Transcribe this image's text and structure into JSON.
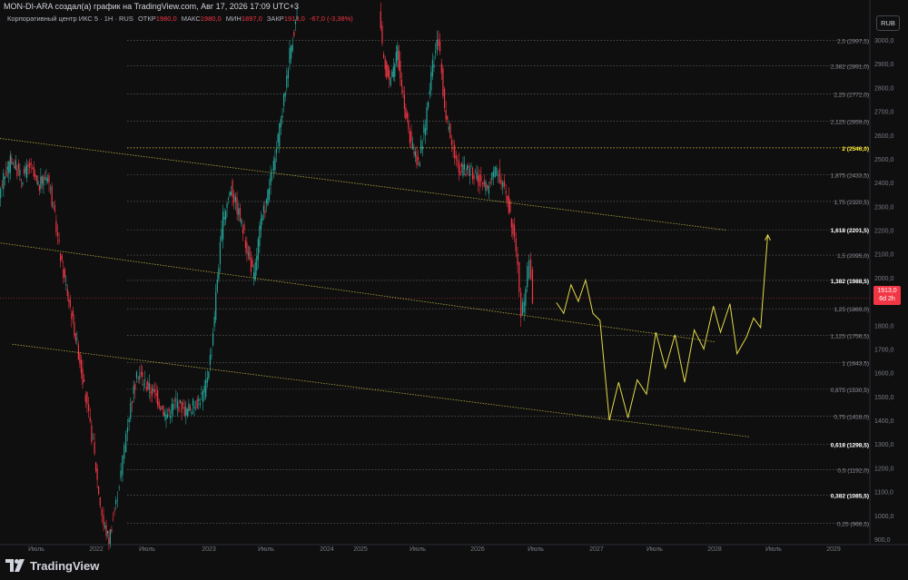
{
  "header": {
    "credit": "MON-DI-ARA создал(а) график на TradingView.com, Авг 17, 2026 17:09 UTC+3",
    "symbol": "Корпоративный центр ИКС 5 · 1Н · RUS",
    "open_label": "ОТКР",
    "open_value": "1980,0",
    "high_label": "МАКС",
    "high_value": "1980,0",
    "low_label": "МИН",
    "low_value": "1897,0",
    "close_label": "ЗАКР",
    "close_value": "1913,0",
    "change": "-67,0 (-3,38%)"
  },
  "currency": "RUB",
  "price_tag": {
    "value": "1913,0",
    "countdown": "6d 2h"
  },
  "brand": {
    "name": "TradingView",
    "icon": "tradingview-logo-icon"
  },
  "colors": {
    "background": "#0f0f0f",
    "up": "#26a69a",
    "down": "#f23645",
    "fib_line": "#8a8a8a",
    "fib_highlight": "#ffeb3b",
    "trend": "#d4c84a",
    "projection": "#e3d94a",
    "axis_text": "#787b86"
  },
  "chart_data": {
    "type": "candlestick",
    "title": "",
    "xlabel": "",
    "ylabel": "",
    "ylim": [
      850,
      3100
    ],
    "grid": false,
    "y_ticks": [
      900,
      1000,
      1100,
      1200,
      1300,
      1400,
      1500,
      1600,
      1700,
      1800,
      1900,
      2000,
      2100,
      2200,
      2300,
      2400,
      2500,
      2600,
      2700,
      2800,
      2900,
      3000
    ],
    "y_tick_labels": [
      "900,0",
      "1000,0",
      "1100,0",
      "1200,0",
      "1300,0",
      "1400,0",
      "1500,0",
      "1600,0",
      "1700,0",
      "1800,0",
      "1900,0",
      "2000,0",
      "2100,0",
      "2200,0",
      "2300,0",
      "2400,0",
      "2500,0",
      "2600,0",
      "2700,0",
      "2800,0",
      "2900,0",
      "3000,0"
    ],
    "x_labels": [
      {
        "t": 2021.5,
        "label": "Июль"
      },
      {
        "t": 2022.0,
        "label": "2022"
      },
      {
        "t": 2022.5,
        "label": "Июль"
      },
      {
        "t": 2023.0,
        "label": "2023"
      },
      {
        "t": 2023.5,
        "label": "Июль"
      },
      {
        "t": 2024.0,
        "label": "2024"
      },
      {
        "t": 2024.25,
        "label": "2025"
      },
      {
        "t": 2024.75,
        "label": "Июль"
      },
      {
        "t": 2025.25,
        "label": "2026"
      },
      {
        "t": 2025.75,
        "label": "Июль"
      },
      {
        "t": 2026.25,
        "label": "2027"
      },
      {
        "t": 2026.75,
        "label": "Июль"
      },
      {
        "t": 2027.25,
        "label": "2028"
      },
      {
        "t": 2027.75,
        "label": "Июль"
      },
      {
        "t": 2028.25,
        "label": "2029"
      }
    ],
    "fib_levels": [
      {
        "ratio": "2,5",
        "price": 2997.5,
        "label": "2,5 (2997,5)"
      },
      {
        "ratio": "2,382",
        "price": 2891.0,
        "label": "2,382 (2891,0)"
      },
      {
        "ratio": "2,25",
        "price": 2772.0,
        "label": "2,25 (2772,0)"
      },
      {
        "ratio": "2,125",
        "price": 2659.0,
        "label": "2,125 (2659,0)"
      },
      {
        "ratio": "2",
        "price": 2546.0,
        "label": "2 (2546,0)",
        "highlight": true
      },
      {
        "ratio": "1,875",
        "price": 2433.5,
        "label": "1,875 (2433,5)"
      },
      {
        "ratio": "1,75",
        "price": 2320.5,
        "label": "1,75 (2320,5)"
      },
      {
        "ratio": "1,618",
        "price": 2201.5,
        "label": "1,618 (2201,5)",
        "bold": true
      },
      {
        "ratio": "1,5",
        "price": 2095.0,
        "label": "1,5 (2095,0)"
      },
      {
        "ratio": "1,382",
        "price": 1988.5,
        "label": "1,382 (1988,5)",
        "bold": true
      },
      {
        "ratio": "1,25",
        "price": 1869.0,
        "label": "1,25 (1869,0)"
      },
      {
        "ratio": "1,125",
        "price": 1756.5,
        "label": "1,125 (1756,5)"
      },
      {
        "ratio": "1",
        "price": 1643.5,
        "label": "1 (1643,5)"
      },
      {
        "ratio": "0,875",
        "price": 1530.5,
        "label": "0,875 (1530,5)"
      },
      {
        "ratio": "0,75",
        "price": 1418.0,
        "label": "0,75 (1418,0)"
      },
      {
        "ratio": "0,618",
        "price": 1298.5,
        "label": "0,618 (1298,5)",
        "bold": true
      },
      {
        "ratio": "0,5",
        "price": 1192.0,
        "label": "0,5 (1192,0)"
      },
      {
        "ratio": "0,382",
        "price": 1085.5,
        "label": "0,382 (1085,5)",
        "bold": true
      },
      {
        "ratio": "0,25",
        "price": 966.5,
        "label": "0,25 (966,5)"
      }
    ],
    "price_path": [
      [
        2021.0,
        2430
      ],
      [
        2021.1,
        2300
      ],
      [
        2021.15,
        2180
      ],
      [
        2021.22,
        2400
      ],
      [
        2021.3,
        2500
      ],
      [
        2021.38,
        2420
      ],
      [
        2021.45,
        2470
      ],
      [
        2021.52,
        2380
      ],
      [
        2021.6,
        2440
      ],
      [
        2021.66,
        2250
      ],
      [
        2021.72,
        2050
      ],
      [
        2021.8,
        1850
      ],
      [
        2021.88,
        1620
      ],
      [
        2021.93,
        1450
      ],
      [
        2021.98,
        1300
      ],
      [
        2022.03,
        1100
      ],
      [
        2022.08,
        960
      ],
      [
        2022.13,
        900
      ],
      [
        2022.2,
        1050
      ],
      [
        2022.25,
        1180
      ],
      [
        2022.3,
        1350
      ],
      [
        2022.36,
        1500
      ],
      [
        2022.42,
        1600
      ],
      [
        2022.5,
        1550
      ],
      [
        2022.58,
        1500
      ],
      [
        2022.66,
        1420
      ],
      [
        2022.74,
        1480
      ],
      [
        2022.82,
        1440
      ],
      [
        2022.9,
        1470
      ],
      [
        2022.97,
        1520
      ],
      [
        2023.03,
        1700
      ],
      [
        2023.08,
        2000
      ],
      [
        2023.13,
        2250
      ],
      [
        2023.2,
        2380
      ],
      [
        2023.28,
        2250
      ],
      [
        2023.35,
        2100
      ],
      [
        2023.4,
        2000
      ],
      [
        2023.45,
        2200
      ],
      [
        2023.52,
        2350
      ],
      [
        2023.58,
        2500
      ],
      [
        2023.64,
        2700
      ],
      [
        2023.7,
        2950
      ],
      [
        2023.76,
        3100
      ]
    ],
    "price_path_2": [
      [
        2024.42,
        3100
      ],
      [
        2024.46,
        2900
      ],
      [
        2024.52,
        2820
      ],
      [
        2024.58,
        2950
      ],
      [
        2024.64,
        2700
      ],
      [
        2024.7,
        2560
      ],
      [
        2024.76,
        2480
      ],
      [
        2024.82,
        2650
      ],
      [
        2024.88,
        2900
      ],
      [
        2024.93,
        3000
      ],
      [
        2024.98,
        2720
      ],
      [
        2025.04,
        2550
      ],
      [
        2025.1,
        2460
      ],
      [
        2025.18,
        2450
      ],
      [
        2025.26,
        2420
      ],
      [
        2025.34,
        2380
      ],
      [
        2025.42,
        2450
      ],
      [
        2025.5,
        2360
      ],
      [
        2025.56,
        2200
      ],
      [
        2025.6,
        2050
      ],
      [
        2025.63,
        1830
      ],
      [
        2025.67,
        1950
      ],
      [
        2025.7,
        2100
      ],
      [
        2025.73,
        1913
      ]
    ],
    "trend_lines": [
      {
        "name": "upper-channel",
        "p1": [
          2021.13,
          2590
        ],
        "p2": [
          2027.35,
          2200
        ]
      },
      {
        "name": "middle-channel",
        "p1": [
          2021.0,
          2160
        ],
        "p2": [
          2027.25,
          1730
        ]
      },
      {
        "name": "lower-channel",
        "p1": [
          2021.3,
          1720
        ],
        "p2": [
          2027.55,
          1330
        ]
      }
    ],
    "projection": [
      [
        2025.92,
        1895
      ],
      [
        2025.98,
        1850
      ],
      [
        2026.04,
        1970
      ],
      [
        2026.1,
        1900
      ],
      [
        2026.16,
        1990
      ],
      [
        2026.22,
        1850
      ],
      [
        2026.28,
        1820
      ],
      [
        2026.36,
        1400
      ],
      [
        2026.44,
        1560
      ],
      [
        2026.52,
        1410
      ],
      [
        2026.6,
        1570
      ],
      [
        2026.68,
        1510
      ],
      [
        2026.76,
        1770
      ],
      [
        2026.84,
        1620
      ],
      [
        2026.92,
        1760
      ],
      [
        2027.0,
        1560
      ],
      [
        2027.08,
        1780
      ],
      [
        2027.16,
        1700
      ],
      [
        2027.24,
        1880
      ],
      [
        2027.3,
        1770
      ],
      [
        2027.38,
        1890
      ],
      [
        2027.44,
        1680
      ],
      [
        2027.52,
        1750
      ],
      [
        2027.58,
        1830
      ],
      [
        2027.64,
        1790
      ],
      [
        2027.7,
        2180
      ]
    ]
  }
}
